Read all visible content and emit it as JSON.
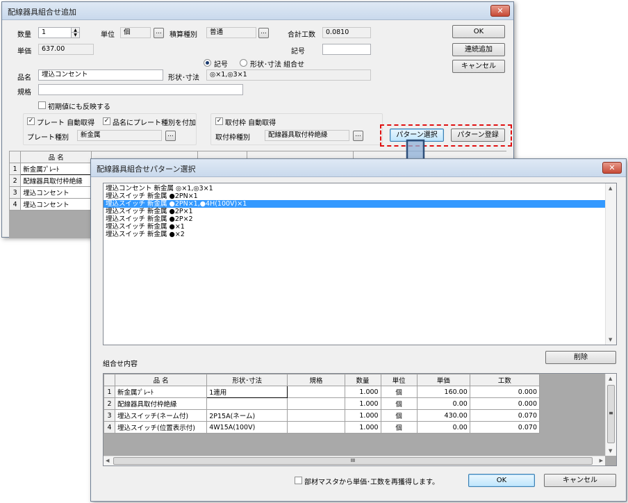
{
  "main_dialog": {
    "title": "配線器具組合せ追加",
    "close_glyph": "✕",
    "quantity_label": "数量",
    "quantity_value": "1",
    "unit_label": "単位",
    "unit_value": "個",
    "estimate_type_label": "積算種別",
    "estimate_type_value": "普通",
    "total_labor_label": "合計工数",
    "total_labor_value": "0.0810",
    "unit_price_label": "単価",
    "unit_price_value": "637.00",
    "symbol_label": "記号",
    "symbol_value": "",
    "radio_symbol_label": "記号",
    "radio_shape_label": "形状･寸法 組合せ",
    "product_name_label": "品名",
    "product_name_value": "埋込コンセント",
    "shape_size_label": "形状･寸法",
    "shape_size_value": "◎×1,◎3×1",
    "spec_label": "規格",
    "spec_value": "",
    "reflect_initial_label": "初期値にも反映する",
    "plate_auto_label": "プレート 自動取得",
    "plate_name_append_label": "品名にプレート種別を付加",
    "plate_type_label": "プレート種別",
    "plate_type_value": "新金属",
    "frame_auto_label": "取付枠 自動取得",
    "frame_type_label": "取付枠種別",
    "frame_type_value": "配線器具取付枠絶縁",
    "ellipsis": "...",
    "ok_button": "OK",
    "continuous_add_button": "連続追加",
    "cancel_button": "キャンセル",
    "pattern_select_button": "パターン選択",
    "pattern_register_button": "パターン登録",
    "grid_header_name": "品 名",
    "grid_rows": [
      {
        "no": "1",
        "name": "新金属ﾌﾟﾚｰﾄ"
      },
      {
        "no": "2",
        "name": "配線器具取付枠絶縁"
      },
      {
        "no": "3",
        "name": "埋込コンセント"
      },
      {
        "no": "4",
        "name": "埋込コンセント"
      }
    ]
  },
  "pattern_dialog": {
    "title": "配線器具組合せパターン選択",
    "close_glyph": "✕",
    "patterns": [
      "埋込コンセント 新金属 ◎×1,◎3×1",
      "埋込スイッチ 新金属 ●2PN×1",
      "埋込スイッチ 新金属 ●2PN×1,●4H(100V)×1",
      "埋込スイッチ 新金属 ●2P×1",
      "埋込スイッチ 新金属 ●2P×2",
      "埋込スイッチ 新金属 ●×1",
      "埋込スイッチ 新金属 ●×2"
    ],
    "selected_index": 2,
    "combination_label": "組合せ内容",
    "delete_button": "削除",
    "columns": [
      "品 名",
      "形状･寸法",
      "規格",
      "数量",
      "単位",
      "単価",
      "工数"
    ],
    "rows": [
      {
        "no": "1",
        "name": "新金属ﾌﾟﾚｰﾄ",
        "shape": "1連用",
        "spec": "",
        "qty": "1.000",
        "unit": "個",
        "price": "160.00",
        "labor": "0.000"
      },
      {
        "no": "2",
        "name": "配線器具取付枠絶縁",
        "shape": "",
        "spec": "",
        "qty": "1.000",
        "unit": "個",
        "price": "0.00",
        "labor": "0.000"
      },
      {
        "no": "3",
        "name": "埋込スイッチ(ネーム付)",
        "shape": "2P15A(ネーム)",
        "spec": "",
        "qty": "1.000",
        "unit": "個",
        "price": "430.00",
        "labor": "0.070"
      },
      {
        "no": "4",
        "name": "埋込スイッチ(位置表示付)",
        "shape": "4W15A(100V)",
        "spec": "",
        "qty": "1.000",
        "unit": "個",
        "price": "0.00",
        "labor": "0.070"
      }
    ],
    "reacquire_label": "部材マスタから単価･工数を再獲得します。",
    "ok_button": "OK",
    "cancel_button": "キャンセル",
    "hscroll_grip": "III",
    "vscroll_grip": "≡"
  },
  "colors": {
    "highlight_dashed": "#e01010",
    "arrow_fill": "#8fb0d8",
    "arrow_stroke": "#2e4f7a",
    "selection": "#3399ff"
  }
}
